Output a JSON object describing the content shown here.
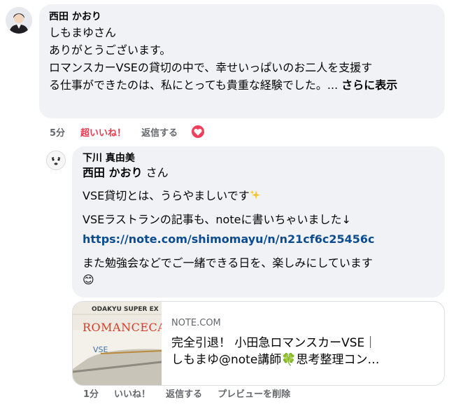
{
  "main_comment": {
    "author": "西田 かおり",
    "lines": [
      "しもまゆさん",
      "ありがとうございます。",
      "ロマンスカーVSEの貸切の中で、幸せいっぱいのお二人を支援す",
      "る仕事ができたのは、私にとっても貴重な経験でした。..."
    ],
    "see_more": "さらに表示",
    "time": "5分",
    "reaction_label": "超いいね！",
    "reply_label": "返信する",
    "reaction_icon": "heart-reaction-icon"
  },
  "reply_comment": {
    "author": "下川 真由美",
    "mention": "西田 かおり",
    "mention_suffix": " さん",
    "para1": "VSE貸切とは、うらやましいです",
    "para2": "VSEラストランの記事も、noteに書いちゃいました↓",
    "link": "https://note.com/shimomayu/n/n21cf6c25456c",
    "para3a": "また勉強会などでご一緒できる日を、楽しみにしています",
    "para3_emoji": "😊",
    "sparkle_icon": "sparkles-icon",
    "time": "1分",
    "like_label": "いいね！",
    "reply_label": "返信する",
    "remove_preview_label": "プレビューを削除"
  },
  "link_preview": {
    "domain": "NOTE.COM",
    "title_line1": "完全引退！ 小田急ロマンスカーVSE｜",
    "title_line2": "しもまゆ@note講師🍀思考整理コン…",
    "thumb_text_top": "ODAKYU  SUPER EX",
    "thumb_text_brand": "ROMANCECA",
    "thumb_text_vse": "VSE"
  },
  "colors": {
    "bubble": "#f0f2f5",
    "link": "#0a4c8f",
    "super_like": "#e53d4f",
    "meta": "#65676b"
  }
}
